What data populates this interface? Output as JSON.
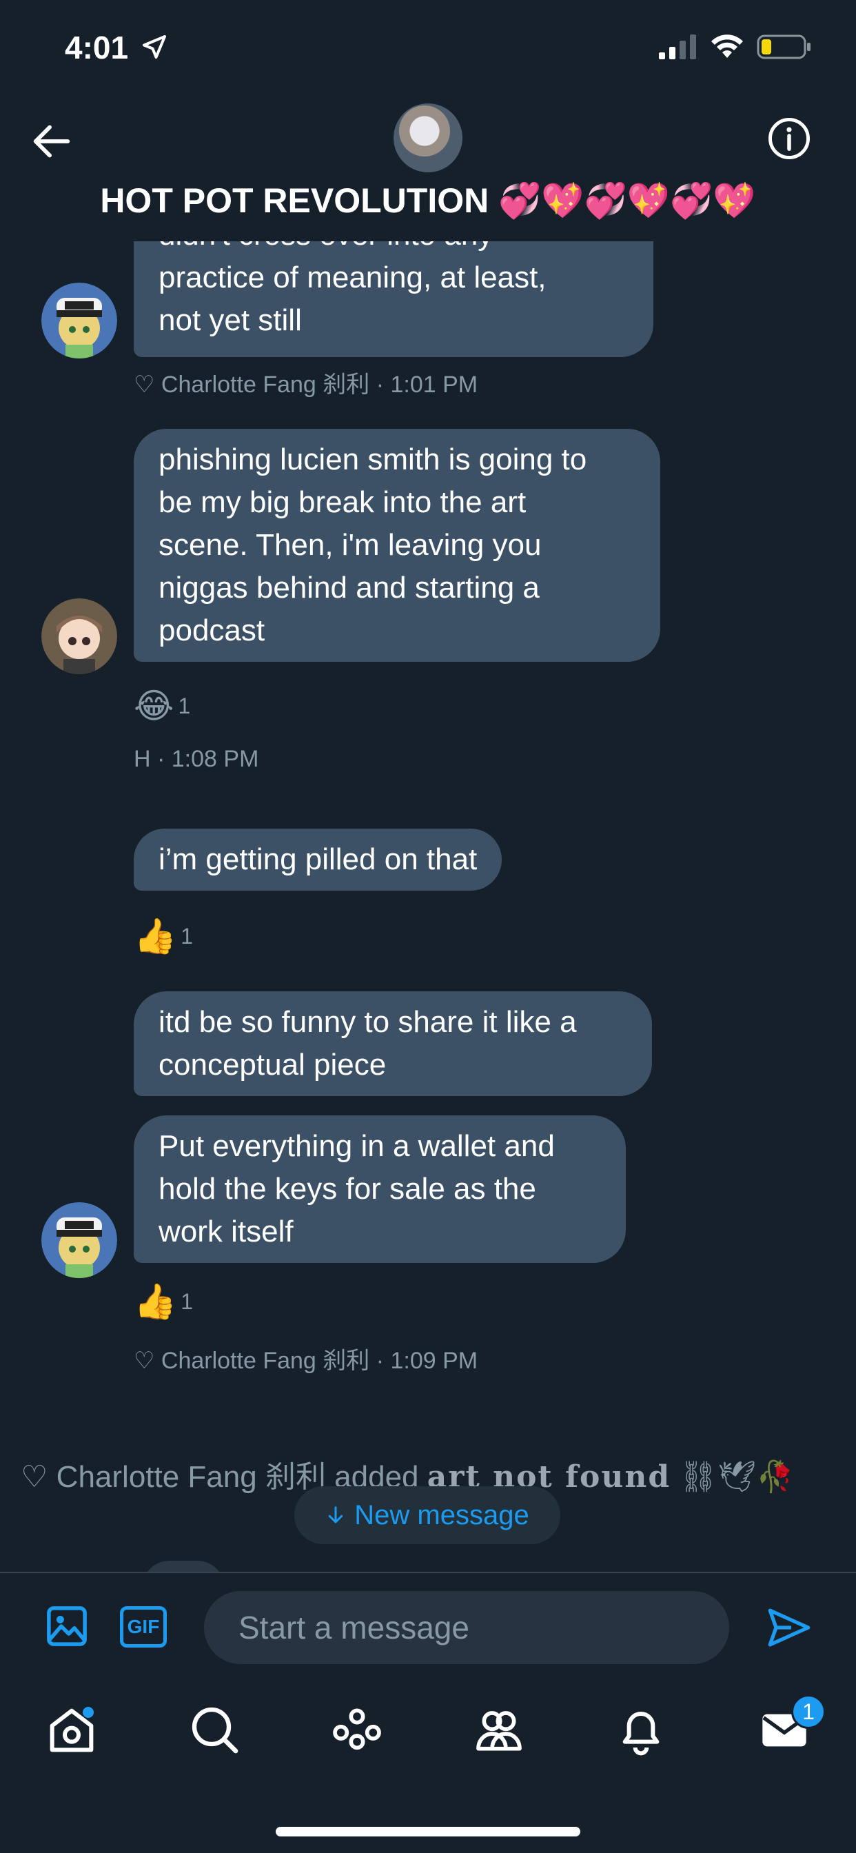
{
  "status_bar": {
    "time": "4:01"
  },
  "header": {
    "title": "HOT POT REVOLUTION 💞💖💞💖💞💖"
  },
  "messages": [
    {
      "lines": [
        "didn't cross over into any",
        "practice of meaning, at least,",
        "not yet still"
      ],
      "sender": "Charlotte"
    },
    {
      "meta": "♡ Charlotte Fang 刹利 · 1:01 PM"
    },
    {
      "lines": [
        "phishing lucien smith is going to",
        "be my big break into the art",
        "scene. Then, i'm leaving you",
        "niggas behind and starting a",
        "podcast"
      ],
      "sender": "H"
    },
    {
      "reaction": {
        "emoji": "😂",
        "count": "1"
      }
    },
    {
      "meta": "H · 1:08 PM"
    },
    {
      "lines": [
        "i’m getting pilled on that"
      ]
    },
    {
      "reaction": {
        "emoji": "👍",
        "count": "1"
      }
    },
    {
      "lines": [
        "itd be so funny to share it like a",
        "conceptual piece"
      ]
    },
    {
      "lines": [
        "Put everything in a wallet and",
        "hold the keys for sale as the",
        "work itself"
      ],
      "sender": "Charlotte"
    },
    {
      "reaction": {
        "emoji": "👍",
        "count": "1"
      }
    },
    {
      "meta": "♡ Charlotte Fang 刹利 · 1:09 PM"
    }
  ],
  "system_message": {
    "text": "♡ Charlotte Fang 刹利 added ",
    "styled": "art not found",
    "emojis": "⛓🕊🥀"
  },
  "new_message_pill": {
    "label": "New message"
  },
  "composer": {
    "gif_label": "GIF",
    "placeholder": "Start a message"
  },
  "tabbar": {
    "messages_badge": "1"
  },
  "colors": {
    "background": "#15202b",
    "bubble": "#3d5166",
    "accent": "#1d9bf0",
    "muted": "#8899a6"
  }
}
